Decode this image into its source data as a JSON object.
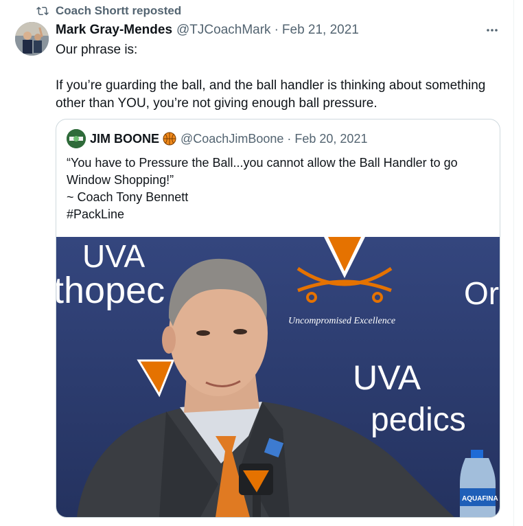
{
  "repost": {
    "label": "Coach Shortt reposted"
  },
  "post": {
    "author_name": "Mark Gray-Mendes",
    "handle": "@TJCoachMark",
    "date": "Feb 21, 2021",
    "lines": [
      "Our phrase is:",
      "If you’re guarding the ball, and the ball handler is thinking about something other than YOU, you’re not giving enough ball pressure."
    ]
  },
  "quote": {
    "author_name": "JIM BOONE",
    "handle": "@CoachJimBoone",
    "date": "Feb 20, 2021",
    "lines": [
      "“You have to Pressure the Ball...you cannot allow the Ball Handler to go Window Shopping!”",
      "~ Coach Tony Bennett",
      "#PackLine"
    ],
    "image": {
      "backdrop_texts": [
        "UVA",
        "thopec",
        "Or",
        "Uncompromised Excellence",
        "UVA",
        "pedics"
      ],
      "bottle_label": "AQUAFINA"
    }
  },
  "icons": {
    "repost": "repost-icon",
    "more": "more-icon",
    "badge": "basketball-icon"
  },
  "colors": {
    "text_primary": "#0f1419",
    "text_secondary": "#536471",
    "border": "#cfd9de",
    "backdrop_blue": "#2b3a6e",
    "uva_orange": "#e57200",
    "suit": "#3a3d42"
  }
}
